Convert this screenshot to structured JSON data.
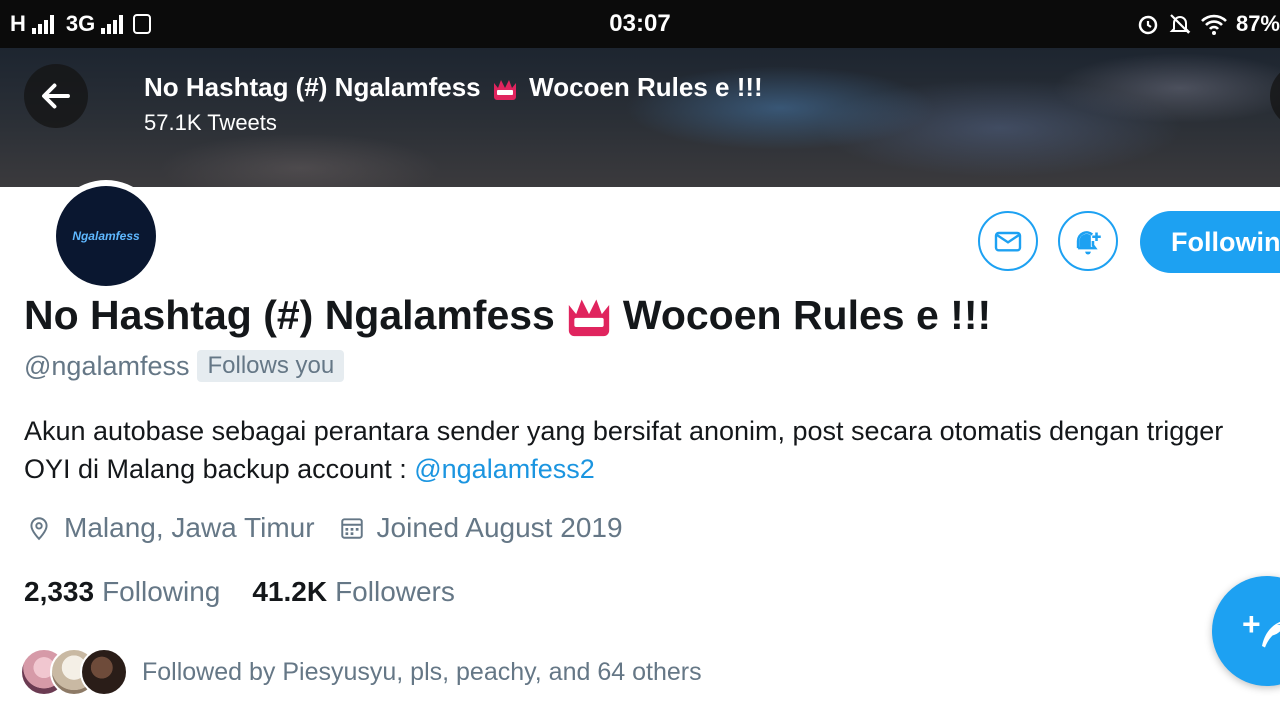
{
  "status_bar": {
    "network1": "H",
    "network2": "3G",
    "time": "03:07",
    "battery": "87%"
  },
  "header": {
    "title_part1": "No Hashtag (#) Ngalamfess",
    "title_part2": "Wocoen Rules e !!!",
    "tweets_count": "57.1K Tweets"
  },
  "profile": {
    "avatar_text": "Ngalamfess",
    "name_part1": "No Hashtag (#) Ngalamfess",
    "name_part2": "Wocoen Rules e !!!",
    "handle": "@ngalamfess",
    "follows_you": "Follows you",
    "bio_text": "Akun autobase sebagai perantara sender yang bersifat anonim, post secara otomatis dengan trigger OYI di Malang backup account : ",
    "bio_link": "@ngalamfess2",
    "location": "Malang, Jawa Timur",
    "joined": "Joined August 2019",
    "following_count": "2,333",
    "following_label": "Following",
    "followers_count": "41.2K",
    "followers_label": "Followers",
    "followed_by": "Followed by Piesyusyu, pls, peachy, and 64 others"
  },
  "actions": {
    "follow_button": "Following",
    "fab_plus": "+"
  },
  "colors": {
    "accent": "#1da1f2",
    "text_secondary": "#657786",
    "text_primary": "#14171a",
    "emoji_red": "#e0245e"
  },
  "icons": [
    "back-arrow-icon",
    "mail-icon",
    "bell-plus-icon",
    "location-pin-icon",
    "calendar-icon",
    "compose-icon",
    "alarm-icon",
    "mute-icon",
    "wifi-icon"
  ]
}
